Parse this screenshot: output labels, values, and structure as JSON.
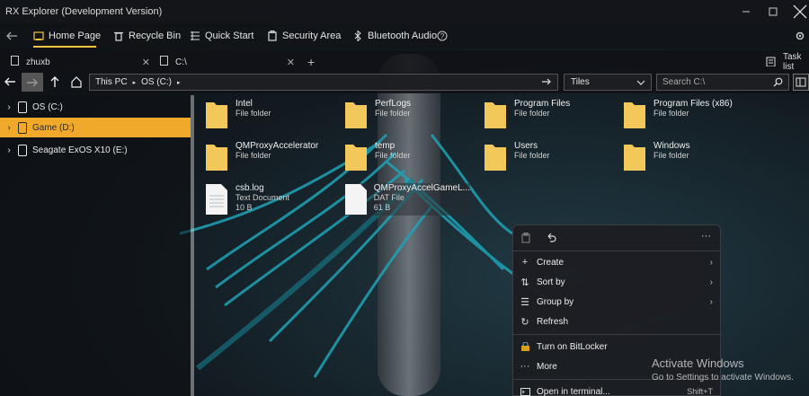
{
  "window": {
    "title": "RX Explorer (Development Version)",
    "minimize_icon": "minimize-icon",
    "maximize_icon": "maximize-icon",
    "close_icon": "close-icon"
  },
  "toolbar": {
    "items": [
      {
        "label": "Home Page",
        "icon": "home-icon"
      },
      {
        "label": "Recycle Bin",
        "icon": "trash-icon"
      },
      {
        "label": "Quick Start",
        "icon": "list-icon"
      },
      {
        "label": "Security Area",
        "icon": "shield-icon"
      },
      {
        "label": "Bluetooth Audio",
        "icon": "bluetooth-icon"
      }
    ]
  },
  "tabs": [
    {
      "label": "zhuxb"
    },
    {
      "label": "C:\\"
    }
  ],
  "task_list_label": "Task list",
  "address": {
    "segments": [
      "This PC",
      "OS (C:)"
    ],
    "view_mode": "Tiles",
    "search_placeholder": "Search C:\\"
  },
  "sidebar": {
    "items": [
      {
        "label": "OS (C:)",
        "selected": false
      },
      {
        "label": "Game (D:)",
        "selected": true
      },
      {
        "label": "Seagate ExOS X10 (E:)",
        "selected": false
      }
    ]
  },
  "files": [
    {
      "name": "Intel",
      "type": "File folder",
      "size": ""
    },
    {
      "name": "PerfLogs",
      "type": "File folder",
      "size": ""
    },
    {
      "name": "Program Files",
      "type": "File folder",
      "size": ""
    },
    {
      "name": "Program Files (x86)",
      "type": "File folder",
      "size": ""
    },
    {
      "name": "QMProxyAccelerator",
      "type": "File folder",
      "size": ""
    },
    {
      "name": "temp",
      "type": "File folder",
      "size": ""
    },
    {
      "name": "Users",
      "type": "File folder",
      "size": ""
    },
    {
      "name": "Windows",
      "type": "File folder",
      "size": ""
    },
    {
      "name": "csb.log",
      "type": "Text Document",
      "size": "10 B"
    },
    {
      "name": "QMProxyAccelGameL...",
      "type": "DAT File",
      "size": "61 B"
    }
  ],
  "context_menu": {
    "items": [
      {
        "label": "Create",
        "icon": "plus-icon",
        "submenu": true,
        "shortcut": ""
      },
      {
        "label": "Sort by",
        "icon": "sort-icon",
        "submenu": true,
        "shortcut": ""
      },
      {
        "label": "Group by",
        "icon": "group-icon",
        "submenu": true,
        "shortcut": ""
      },
      {
        "label": "Refresh",
        "icon": "refresh-icon",
        "submenu": false,
        "shortcut": ""
      },
      {
        "label": "Turn on BitLocker",
        "icon": "bitlocker-icon",
        "submenu": false,
        "shortcut": ""
      },
      {
        "label": "More",
        "icon": "more-icon",
        "submenu": false,
        "shortcut": ""
      },
      {
        "label": "Open in terminal...",
        "icon": "terminal-icon",
        "submenu": false,
        "shortcut": "Shift+T"
      }
    ]
  },
  "watermark": {
    "line1": "Activate Windows",
    "line2": "Go to Settings to activate Windows."
  },
  "colors": {
    "accent": "#f0a92a",
    "tab_underline": "#f5c542",
    "folder": "#f2c85b"
  }
}
